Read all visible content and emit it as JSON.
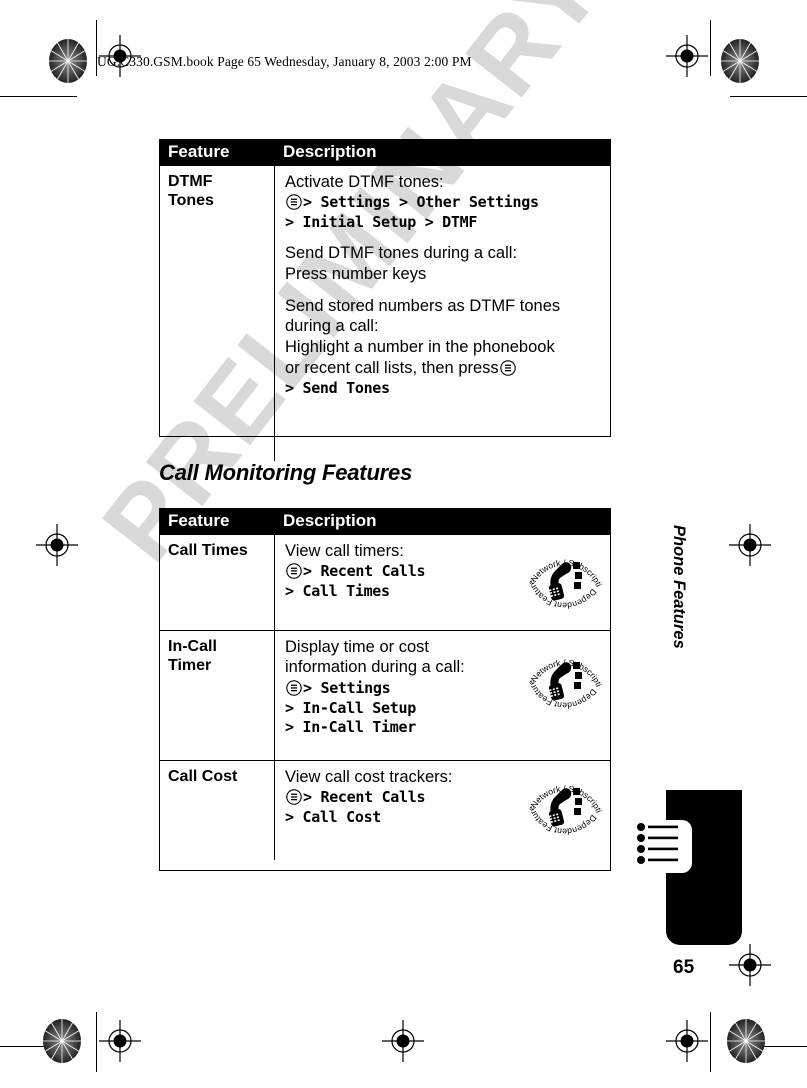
{
  "document": {
    "book_header": "UG.C330.GSM.book  Page 65  Wednesday, January 8, 2003  2:00 PM",
    "watermark": "PRELIMINARY",
    "page_number": "65",
    "chapter_label": "Phone Features"
  },
  "icons": {
    "menu_key": "menu-key-icon",
    "network_badge_top": "Network / Subscription",
    "network_badge_bottom": "Dependent Feature",
    "tab_list": "bulleted-list-icon"
  },
  "table1": {
    "headers": {
      "feature": "Feature",
      "description": "Description"
    },
    "rows": [
      {
        "feature": "DTMF Tones",
        "feature_line1": "DTMF",
        "feature_line2": "Tones",
        "paragraphs": [
          {
            "lead": "Activate DTMF tones:",
            "path_lines": [
              {
                "menu_key": true,
                "text": "> Settings > Other Settings"
              },
              {
                "menu_key": false,
                "text": "> Initial Setup > DTMF"
              }
            ]
          },
          {
            "lead": "Send DTMF tones during a call:",
            "plain_lines": [
              "Press number keys"
            ],
            "path_lines": []
          },
          {
            "lead": "Send stored numbers as DTMF tones",
            "plain_lines": [
              "during a call:",
              "Highlight a number in the phonebook"
            ],
            "trailing_plain": "or recent call lists, then press",
            "path_lines": [
              {
                "menu_key": false,
                "text": "> Send Tones"
              }
            ]
          }
        ]
      }
    ]
  },
  "section": {
    "title": "Call Monitoring Features"
  },
  "table2": {
    "headers": {
      "feature": "Feature",
      "description": "Description"
    },
    "rows": [
      {
        "feature": "Call Times",
        "lead": "View call timers:",
        "path_lines": [
          {
            "menu_key": true,
            "text": "> Recent Calls"
          },
          {
            "menu_key": false,
            "text": "> Call Times"
          }
        ],
        "badge": true
      },
      {
        "feature": "In-Call Timer",
        "feature_line1": "In-Call",
        "feature_line2": "Timer",
        "lead": "Display time or cost",
        "lead2": "information during a call:",
        "path_lines": [
          {
            "menu_key": true,
            "text": "> Settings"
          },
          {
            "menu_key": false,
            "text": "> In-Call Setup"
          },
          {
            "menu_key": false,
            "text": "> In-Call Timer"
          }
        ],
        "badge": true
      },
      {
        "feature": "Call Cost",
        "lead": "View call cost trackers:",
        "path_lines": [
          {
            "menu_key": true,
            "text": "> Recent Calls"
          },
          {
            "menu_key": false,
            "text": "> Call Cost"
          }
        ],
        "badge": true
      }
    ]
  }
}
